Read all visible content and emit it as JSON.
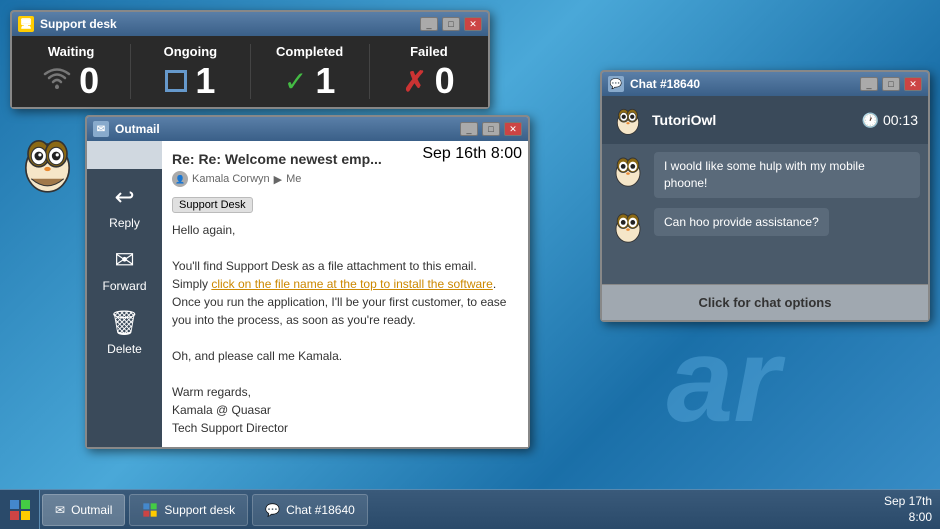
{
  "background": {
    "watermark_text": "ar"
  },
  "support_desk": {
    "title": "Support desk",
    "stats": [
      {
        "label": "Waiting",
        "value": "0",
        "icon_type": "wifi"
      },
      {
        "label": "Ongoing",
        "value": "1",
        "icon_type": "square"
      },
      {
        "label": "Completed",
        "value": "1",
        "icon_type": "check"
      },
      {
        "label": "Failed",
        "value": "0",
        "icon_type": "x"
      }
    ],
    "titlebar_buttons": [
      "minimize",
      "restore",
      "close"
    ]
  },
  "outmail": {
    "title": "Outmail",
    "email": {
      "subject": "Re: Re: Welcome newest emp...",
      "date": "Sep 16th 8:00",
      "from": "Kamala Corwyn",
      "to": "Me",
      "tag": "Support Desk",
      "body_lines": [
        "Hello again,",
        "",
        "You'll find Support Desk as a file attachment to this email.",
        "Simply click on the file name at the top to install the",
        "software. Once you run the application, I'll be your first",
        "customer, to ease you into the process, as soon as you're",
        "ready.",
        "",
        "Oh, and please call me Kamala.",
        "",
        "Warm regards,",
        "Kamala @ Quasar",
        "Tech Support Director"
      ],
      "highlight_text": "click on the file name at the top to install the software"
    },
    "actions": [
      {
        "label": "Reply",
        "icon": "reply"
      },
      {
        "label": "Forward",
        "icon": "forward"
      },
      {
        "label": "Delete",
        "icon": "delete"
      }
    ]
  },
  "chat": {
    "title": "Chat #18640",
    "user": "TutoriOwl",
    "timer": "00:13",
    "messages": [
      {
        "text": "I woold like some hulp with my mobile phoone!"
      },
      {
        "text": "Can hoo provide assistance?"
      }
    ],
    "options_btn": "Click for chat options"
  },
  "taskbar": {
    "items": [
      {
        "label": "Outmail"
      },
      {
        "label": "Support desk"
      },
      {
        "label": "Chat #18640"
      }
    ],
    "clock": {
      "date": "Sep 17th",
      "time": "8:00"
    }
  }
}
